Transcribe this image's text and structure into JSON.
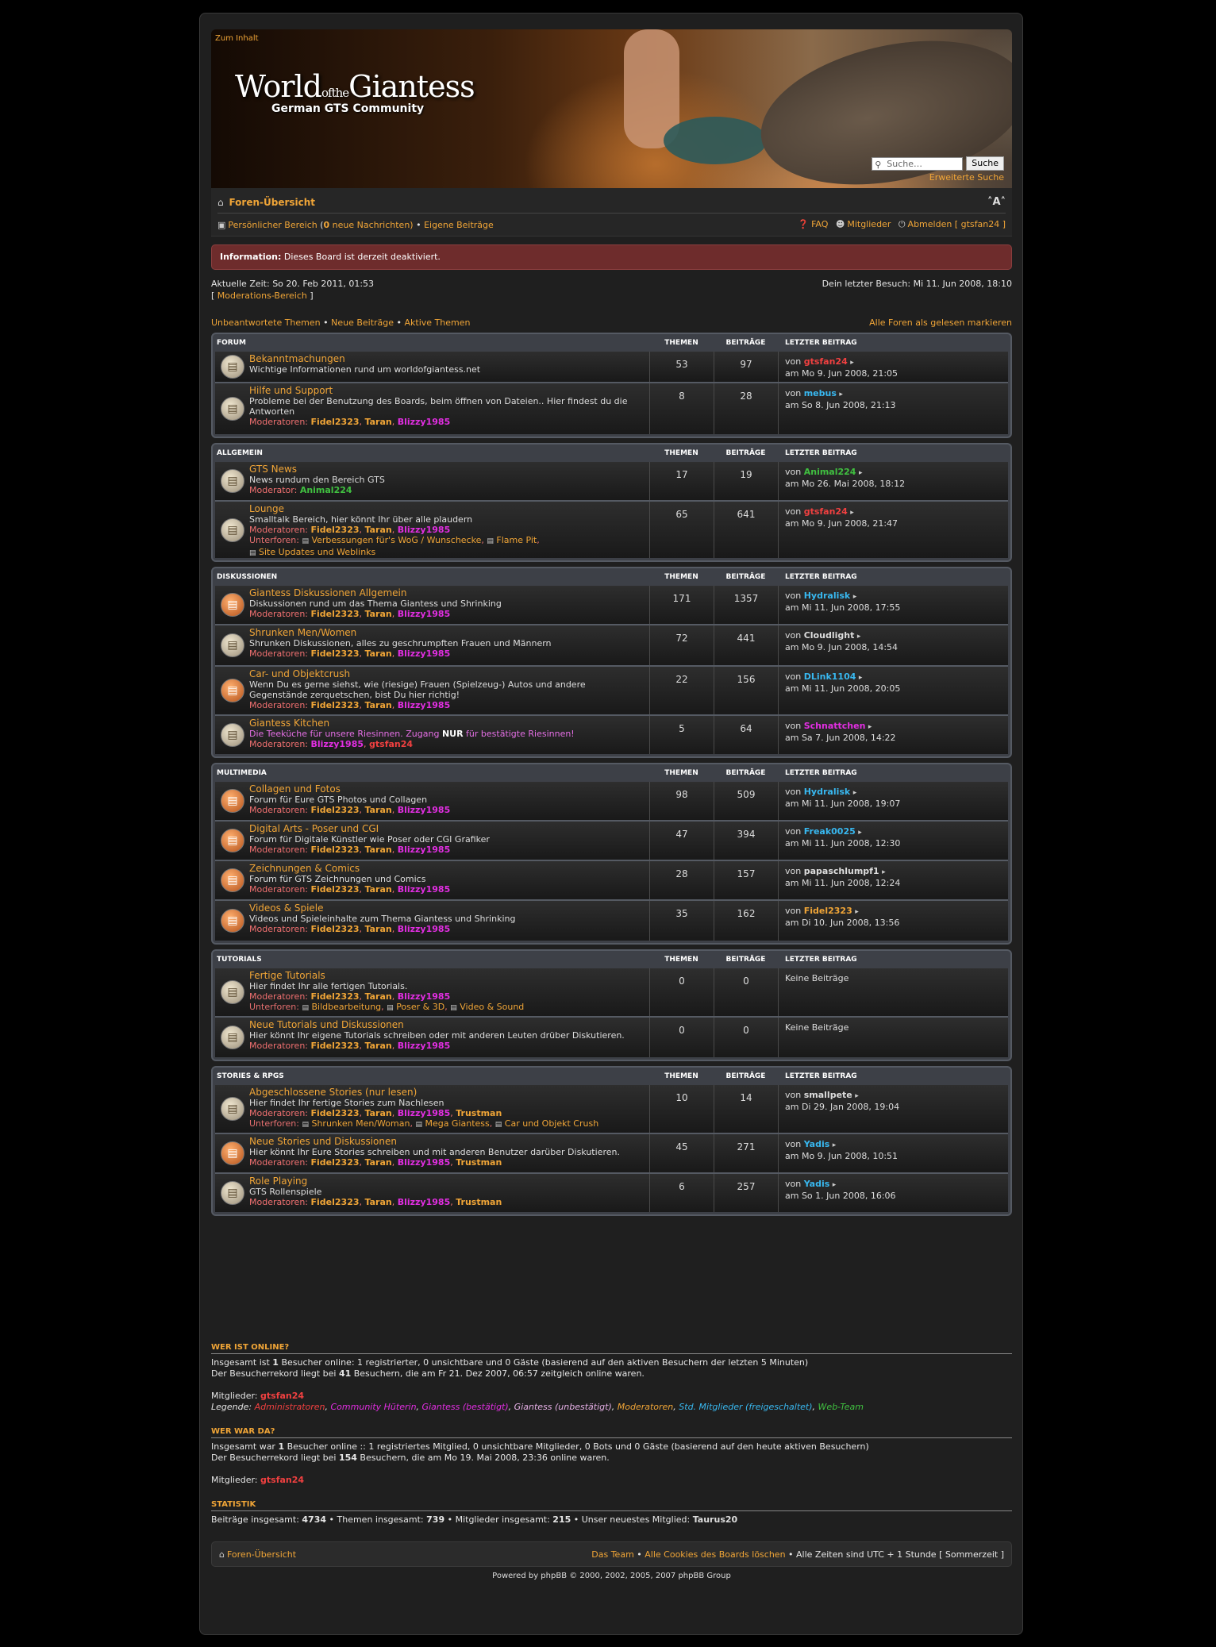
{
  "header": {
    "skip_link": "Zum Inhalt",
    "logo_world": "World",
    "logo_of": "of",
    "logo_the": "the",
    "logo_giantess": "Giantess",
    "logo_sub": "German GTS Community",
    "search_placeholder": "Suche…",
    "search_button": "Suche",
    "advanced_search": "Erweiterte Suche"
  },
  "navbar": {
    "board_index": "Foren-Übersicht",
    "font_size": "A",
    "ucp": "Persönlicher Bereich",
    "new_messages_pre": "(",
    "new_messages_count": "0",
    "new_messages_post": " neue Nachrichten)",
    "own_posts": "Eigene Beiträge",
    "faq": "FAQ",
    "members": "Mitglieder",
    "logout": "Abmelden [ gtsfan24 ]"
  },
  "info": {
    "label": "Information:",
    "text": "Dieses Board ist derzeit deaktiviert."
  },
  "times": {
    "current": "Aktuelle Zeit: So 20. Feb 2011, 01:53",
    "mod_pre": "[ ",
    "mod": "Moderations-Bereich",
    "mod_post": " ]",
    "last_visit": "Dein letzter Besuch: Mi 11. Jun 2008, 18:10"
  },
  "quick": {
    "unanswered": "Unbeantwortete Themen",
    "new_posts": "Neue Beiträge",
    "active": "Aktive Themen",
    "sep": " • ",
    "mark_read": "Alle Foren als gelesen markieren"
  },
  "cols": {
    "topics": "THEMEN",
    "posts": "BEITRÄGE",
    "last": "LETZTER BEITRAG"
  },
  "categories": [
    {
      "name": "FORUM"
    },
    {
      "name": "ALLGEMEIN"
    },
    {
      "name": "DISKUSSIONEN"
    },
    {
      "name": "MULTIMEDIA"
    },
    {
      "name": "TUTORIALS"
    },
    {
      "name": "STORIES & RPGS"
    }
  ],
  "forums": {
    "f1": {
      "title": "Bekanntmachungen",
      "desc": "Wichtige Informationen rund um worldofgiantess.net",
      "topics": "53",
      "posts": "97",
      "by": "von ",
      "user": "gtsfan24",
      "date": "am Mo 9. Jun 2008, 21:05"
    },
    "f2": {
      "title": "Hilfe und Support",
      "desc": "Probleme bei der Benutzung des Boards, beim öffnen von Dateien.. Hier findest du die Antworten",
      "topics": "8",
      "posts": "28",
      "by": "von ",
      "user": "mebus",
      "date": "am So 8. Jun 2008, 21:13"
    },
    "f3": {
      "title": "GTS News",
      "desc": "News rundum den Bereich GTS",
      "topics": "17",
      "posts": "19",
      "by": "von ",
      "user": "Animal224",
      "date": "am Mo 26. Mai 2008, 18:12"
    },
    "f4": {
      "title": "Lounge",
      "desc": "Smalltalk Bereich, hier könnt Ihr über alle plaudern",
      "topics": "65",
      "posts": "641",
      "by": "von ",
      "user": "gtsfan24",
      "date": "am Mo 9. Jun 2008, 21:47",
      "sub1": "Verbessungen für's WoG / Wunschecke",
      "sub2": "Flame Pit",
      "sub3": "Site Updates und Weblinks"
    },
    "f5": {
      "title": "Giantess Diskussionen Allgemein",
      "desc": "Diskussionen rund um das Thema Giantess und Shrinking",
      "topics": "171",
      "posts": "1357",
      "by": "von ",
      "user": "Hydralisk",
      "date": "am Mi 11. Jun 2008, 17:55"
    },
    "f6": {
      "title": "Shrunken Men/Women",
      "desc": "Shrunken Diskussionen, alles zu geschrumpften Frauen und Männern",
      "topics": "72",
      "posts": "441",
      "by": "von ",
      "user": "Cloudlight",
      "date": "am Mo 9. Jun 2008, 14:54"
    },
    "f7": {
      "title": "Car- und Objektcrush",
      "desc": "Wenn Du es gerne siehst, wie (riesige) Frauen (Spielzeug-) Autos und andere Gegenstände zerquetschen, bist Du hier richtig!",
      "topics": "22",
      "posts": "156",
      "by": "von ",
      "user": "DLink1104",
      "date": "am Mi 11. Jun 2008, 20:05"
    },
    "f8": {
      "title": "Giantess Kitchen",
      "desc_pre": "Die Teeküche für unsere Riesinnen. Zugang ",
      "desc_bold": "NUR",
      "desc_post": " für bestätigte Riesinnen!",
      "topics": "5",
      "posts": "64",
      "by": "von ",
      "user": "Schnattchen",
      "date": "am Sa 7. Jun 2008, 14:22"
    },
    "f9": {
      "title": "Collagen und Fotos",
      "desc": "Forum für Eure GTS Photos und Collagen",
      "topics": "98",
      "posts": "509",
      "by": "von ",
      "user": "Hydralisk",
      "date": "am Mi 11. Jun 2008, 19:07"
    },
    "f10": {
      "title": "Digital Arts - Poser und CGI",
      "desc": "Forum für Digitale Künstler wie Poser oder CGI Grafiker",
      "topics": "47",
      "posts": "394",
      "by": "von ",
      "user": "Freak0025",
      "date": "am Mi 11. Jun 2008, 12:30"
    },
    "f11": {
      "title": "Zeichnungen & Comics",
      "desc": "Forum für GTS Zeichnungen und Comics",
      "topics": "28",
      "posts": "157",
      "by": "von ",
      "user": "papaschlumpf1",
      "date": "am Mi 11. Jun 2008, 12:24"
    },
    "f12": {
      "title": "Videos & Spiele",
      "desc": "Videos und Spieleinhalte zum Thema Giantess und Shrinking",
      "topics": "35",
      "posts": "162",
      "by": "von ",
      "user": "Fidel2323",
      "date": "am Di 10. Jun 2008, 13:56"
    },
    "f13": {
      "title": "Fertige Tutorials",
      "desc": "Hier findet Ihr alle fertigen Tutorials.",
      "topics": "0",
      "posts": "0",
      "none": "Keine Beiträge",
      "sub1": "Bildbearbeitung",
      "sub2": "Poser & 3D",
      "sub3": "Video & Sound"
    },
    "f14": {
      "title": "Neue Tutorials und Diskussionen",
      "desc": "Hier könnt Ihr eigene Tutorials schreiben oder mit anderen Leuten drüber Diskutieren.",
      "topics": "0",
      "posts": "0",
      "none": "Keine Beiträge"
    },
    "f15": {
      "title": "Abgeschlossene Stories (nur lesen)",
      "desc": "Hier findet Ihr fertige Stories zum Nachlesen",
      "topics": "10",
      "posts": "14",
      "by": "von ",
      "user": "smallpete",
      "date": "am Di 29. Jan 2008, 19:04",
      "sub1": "Shrunken Men/Woman",
      "sub2": "Mega Giantess",
      "sub3": "Car und Objekt Crush"
    },
    "f16": {
      "title": "Neue Stories und Diskussionen",
      "desc": "Hier könnt Ihr Eure Stories schreiben und mit anderen Benutzer darüber Diskutieren.",
      "topics": "45",
      "posts": "271",
      "by": "von ",
      "user": "Yadis",
      "date": "am Mo 9. Jun 2008, 10:51"
    },
    "f17": {
      "title": "Role Playing",
      "desc": "GTS Rollenspiele",
      "topics": "6",
      "posts": "257",
      "by": "von ",
      "user": "Yadis",
      "date": "am So 1. Jun 2008, 16:06"
    }
  },
  "labels": {
    "moderators": "Moderatoren: ",
    "moderator": "Moderator: ",
    "subforums": "Unterforen: ",
    "comma": ", ",
    "sub_comma": ","
  },
  "users": {
    "fidel": "Fidel2323",
    "taran": "Taran",
    "blizzy": "Blizzy1985",
    "trustman": "Trustman",
    "animal": "Animal224",
    "gtsfan": "gtsfan24"
  },
  "online": {
    "title": "WER IST ONLINE?",
    "l1_pre": "Insgesamt ist ",
    "l1_num": "1",
    "l1_post": " Besucher online: 1 registrierter, 0 unsichtbare und 0 Gäste (basierend auf den aktiven Besuchern der letzten 5 Minuten)",
    "l2_pre": "Der Besucherrekord liegt bei ",
    "l2_num": "41",
    "l2_post": " Besuchern, die am Fr 21. Dez 2007, 06:57 zeitgleich online waren.",
    "members_label": "Mitglieder: ",
    "member": "gtsfan24",
    "legend_label": "Legende: ",
    "legend": [
      "Administratoren",
      "Community Hüterin",
      "Giantess (bestätigt)",
      "Giantess (unbestätigt)",
      "Moderatoren",
      "Std. Mitglieder (freigeschaltet)",
      "Web-Team"
    ]
  },
  "today": {
    "title": "WER WAR DA?",
    "l1_pre": "Insgesamt war ",
    "l1_num": "1",
    "l1_post": " Besucher online :: 1 registriertes Mitglied, 0 unsichtbare Mitglieder, 0 Bots und 0 Gäste (basierend auf den heute aktiven Besuchern)",
    "l2_pre": "Der Besucherrekord liegt bei ",
    "l2_num": "154",
    "l2_post": " Besuchern, die am Mo 19. Mai 2008, 23:36 online waren.",
    "members_label": "Mitglieder: ",
    "member": "gtsfan24"
  },
  "stats": {
    "title": "STATISTIK",
    "posts_label": "Beiträge insgesamt: ",
    "posts": "4734",
    "topics_label": " • Themen insgesamt: ",
    "topics": "739",
    "members_label": " • Mitglieder insgesamt: ",
    "members": "215",
    "newest_label": " • Unser neuestes Mitglied: ",
    "newest": "Taurus20"
  },
  "footer": {
    "board_index": "Foren-Übersicht",
    "team": "Das Team",
    "cookies": "Alle Cookies des Boards löschen",
    "tz": " • Alle Zeiten sind UTC + 1 Stunde [ Sommerzeit ]",
    "sep": " • ",
    "powered": "Powered by phpBB © 2000, 2002, 2005, 2007 phpBB Group"
  },
  "colors": {
    "accent": "#f0a537",
    "background": "#1f1f1f",
    "info": "#6e2c2c",
    "category": "#3d4047"
  }
}
